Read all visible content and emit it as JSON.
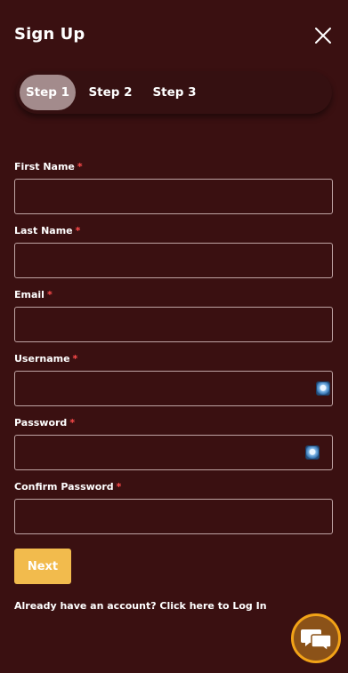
{
  "header": {
    "title": "Sign Up",
    "close_icon": "close-icon"
  },
  "stepper": {
    "steps": [
      {
        "label": "Step 1",
        "active": true
      },
      {
        "label": "Step 2",
        "active": false
      },
      {
        "label": "Step 3",
        "active": false
      }
    ]
  },
  "form": {
    "required_marker": "*",
    "fields": {
      "first_name": {
        "label": "First Name",
        "value": ""
      },
      "last_name": {
        "label": "Last Name",
        "value": ""
      },
      "email": {
        "label": "Email",
        "value": ""
      },
      "username": {
        "label": "Username",
        "value": "",
        "icon": "password-manager-icon"
      },
      "password": {
        "label": "Password",
        "value": "",
        "icon": "password-manager-icon"
      },
      "confirm_password": {
        "label": "Confirm Password",
        "value": ""
      }
    },
    "next_label": "Next",
    "login_prompt": "Already have an account? Click here to Log In"
  },
  "chat": {
    "icon": "chat-bubbles-icon"
  },
  "colors": {
    "background": "#3a1011",
    "active_step": "#a38b8c",
    "next_button": "#f2bb4d",
    "required": "#ff4b4b",
    "chat_border": "#f2a317"
  }
}
